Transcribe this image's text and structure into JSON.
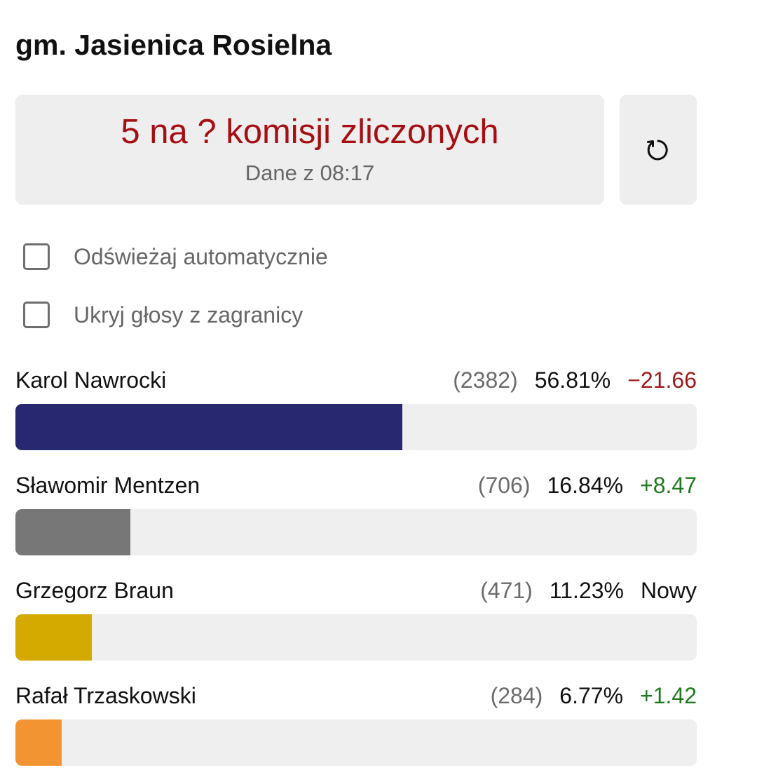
{
  "header": {
    "title": "gm. Jasienica Rosielna"
  },
  "status": {
    "count_text": "5 na ? komisji zliczonych",
    "updated_text": "Dane z 08:17",
    "refresh_icon": "refresh-icon"
  },
  "options": {
    "auto_refresh_label": "Odświeżaj automatycznie",
    "auto_refresh_checked": false,
    "hide_abroad_label": "Ukryj głosy z zagranicy",
    "hide_abroad_checked": false
  },
  "candidates": [
    {
      "name": "Karol Nawrocki",
      "votes": "(2382)",
      "percent_label": "56.81%",
      "percent": 56.81,
      "change": "−21.66",
      "change_type": "neg",
      "color": "#282870"
    },
    {
      "name": "Sławomir Mentzen",
      "votes": "(706)",
      "percent_label": "16.84%",
      "percent": 16.84,
      "change": "+8.47",
      "change_type": "pos",
      "color": "#777777"
    },
    {
      "name": "Grzegorz Braun",
      "votes": "(471)",
      "percent_label": "11.23%",
      "percent": 11.23,
      "change": "Nowy",
      "change_type": "new",
      "color": "#d4a900"
    },
    {
      "name": "Rafał Trzaskowski",
      "votes": "(284)",
      "percent_label": "6.77%",
      "percent": 6.77,
      "change": "+1.42",
      "change_type": "pos",
      "color": "#f39433"
    }
  ]
}
